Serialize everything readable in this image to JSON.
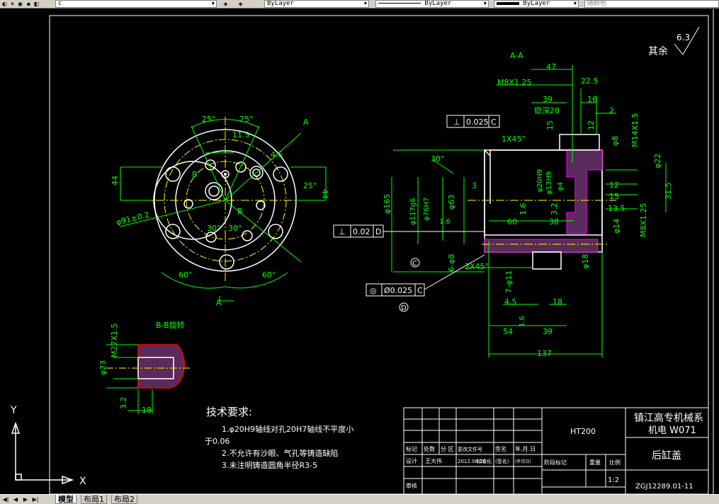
{
  "toolbar": {
    "layer_name": "c",
    "color_value": "ByLayer",
    "linetype_value": "ByLayer",
    "lineweight_value": "ByLayer",
    "plotstyle_value": "随颜色"
  },
  "drawing": {
    "roughness_note": "其余",
    "roughness_value": "6.3",
    "section_label": "A-A",
    "bb_label": "B-B旋转",
    "dims_section": [
      "47",
      "22.5",
      "39",
      "16",
      "M8X1.25",
      "锪深28",
      "15",
      "12",
      "2",
      "M14X1.5",
      "φ8",
      "1X45°",
      "30°",
      "φ22",
      "φ165",
      "φ117g6",
      "φ76H7",
      "φ63",
      "3",
      "φ13H9",
      "φ4",
      "12",
      "15",
      "31.5",
      "13.5",
      "60",
      "38",
      "M8X1.25",
      "φ14",
      "2X45°",
      "6-φ8",
      "φ18",
      "7-φ11",
      "4.5",
      "18",
      "54",
      "39",
      "137",
      "1.6",
      "3.2",
      "φ20H9"
    ],
    "tol_perp_1": "0.025",
    "tol_perp_1_ref": "C",
    "tol_perp_2": "0.02",
    "tol_perp_2_ref": "D",
    "tol_conc": "Ø0.025",
    "tol_conc_ref": "C",
    "datum_c": "C",
    "datum_d": "D",
    "dims_front": [
      "25°",
      "25°",
      "11.5",
      "44",
      "44",
      "25°",
      "φ91±0.2",
      "30°",
      "30°",
      "60°",
      "60°",
      "B",
      "B",
      "A",
      "A",
      "4.5"
    ],
    "dims_bb": [
      "M27X1.5",
      "φ23",
      "3.2",
      "18"
    ]
  },
  "tech_req": {
    "title": "技术要求:",
    "line1a": "1.φ20H9轴线对孔20H7轴线不平度小",
    "line1b": "于0.06",
    "line2": "2.不允许有沙眼、气孔等铸造缺陷",
    "line3": "3.未注明铸造圆角半径R3-5"
  },
  "title_block": {
    "material": "HT200",
    "school": "镇江高专机械系",
    "class_name": "机电 W071",
    "part_name": "后缸盖",
    "drawing_no": "ZGJ12289.01-11",
    "scale": "1:2",
    "row_labels": [
      "标记",
      "处数",
      "分 区",
      "更改文件号",
      "签名",
      "年.月.日"
    ],
    "designer_label": "设计",
    "designer": "王大伟",
    "date": "2012.06.20",
    "std_label": "标准化",
    "sign_label": "(签名)",
    "date_label": "(年月日)",
    "stage_label": "阶段标记",
    "weight_label": "重量",
    "scale_label": "比例",
    "review_label": "审核"
  },
  "ucs": {
    "x": "X",
    "y": "Y"
  },
  "tabs": [
    "模型",
    "布局1",
    "布局2"
  ]
}
